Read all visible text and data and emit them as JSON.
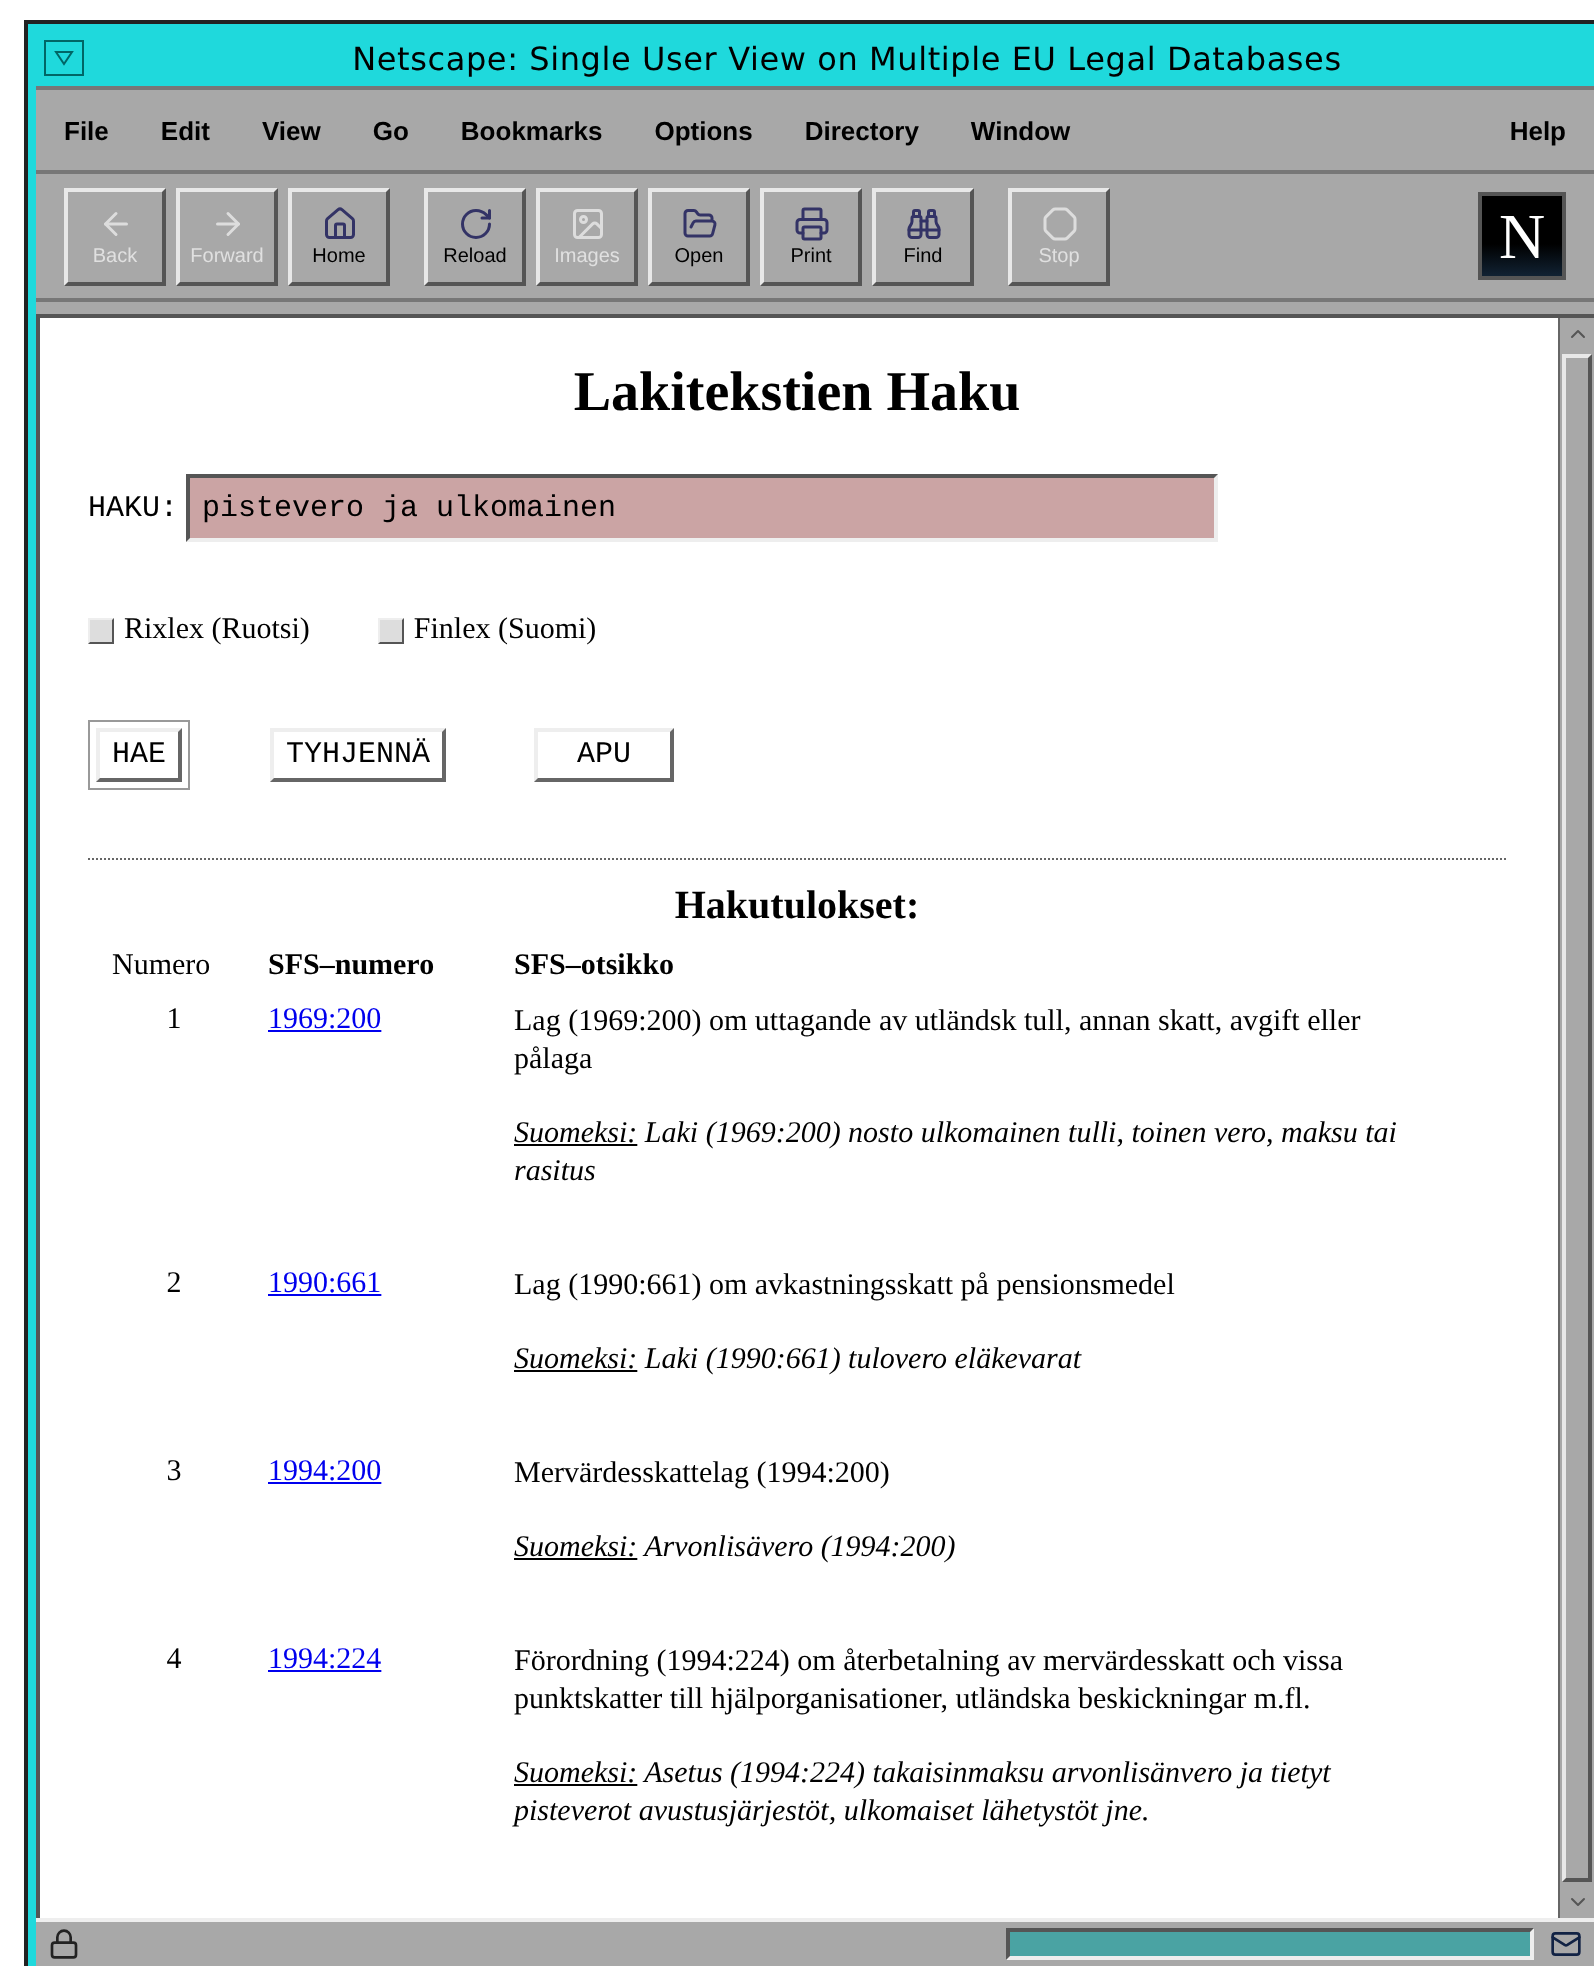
{
  "window": {
    "title": "Netscape: Single User View on Multiple EU Legal Databases"
  },
  "menu": [
    "File",
    "Edit",
    "View",
    "Go",
    "Bookmarks",
    "Options",
    "Directory",
    "Window"
  ],
  "help_menu": "Help",
  "toolbar": [
    {
      "label": "Back",
      "disabled": true
    },
    {
      "label": "Forward",
      "disabled": true
    },
    {
      "label": "Home",
      "disabled": false
    },
    {
      "label": "Reload",
      "disabled": false
    },
    {
      "label": "Images",
      "disabled": true
    },
    {
      "label": "Open",
      "disabled": false
    },
    {
      "label": "Print",
      "disabled": false
    },
    {
      "label": "Find",
      "disabled": false
    },
    {
      "label": "Stop",
      "disabled": true
    }
  ],
  "logo": "N",
  "page": {
    "heading": "Lakitekstien Haku",
    "search": {
      "label": "HAKU:",
      "value": "pistevero ja ulkomainen"
    },
    "databases": [
      {
        "label": "Rixlex (Ruotsi)",
        "checked": false
      },
      {
        "label": "Finlex (Suomi)",
        "checked": false
      }
    ],
    "buttons": [
      {
        "label": "HAE",
        "default": true
      },
      {
        "label": "TYHJENNÄ",
        "default": false
      },
      {
        "label": "APU",
        "default": false
      }
    ],
    "results": {
      "title": "Hakutulokset:",
      "columns": [
        "Numero",
        "SFS–numero",
        "SFS–otsikko"
      ],
      "rows": [
        {
          "number": "1",
          "sfs": "1969:200",
          "title": "Lag (1969:200) om uttagande av utländsk tull, annan skatt, avgift eller pålaga",
          "translation_label": "Suomeksi:",
          "translation": "Laki (1969:200) nosto ulkomainen tulli, toinen vero, maksu tai rasitus"
        },
        {
          "number": "2",
          "sfs": "1990:661",
          "title": "Lag (1990:661) om avkastningsskatt på pensionsmedel",
          "translation_label": "Suomeksi:",
          "translation": "Laki (1990:661) tulovero eläkevarat"
        },
        {
          "number": "3",
          "sfs": "1994:200",
          "title": "Mervärdesskattelag (1994:200)",
          "translation_label": "Suomeksi:",
          "translation": "Arvonlisävero (1994:200)"
        },
        {
          "number": "4",
          "sfs": "1994:224",
          "title": "Förordning (1994:224) om återbetalning av mervärdesskatt och vissa punktskatter till hjälporganisationer, utländska beskickningar m.fl.",
          "translation_label": "Suomeksi:",
          "translation": "Asetus (1994:224) takaisinmaksu arvonlisänvero ja tietyt pisteverot avustusjärjestöt, ulkomaiset lähetystöt jne."
        }
      ]
    }
  },
  "status_bar": {
    "progress": {
      "level": 1
    }
  }
}
